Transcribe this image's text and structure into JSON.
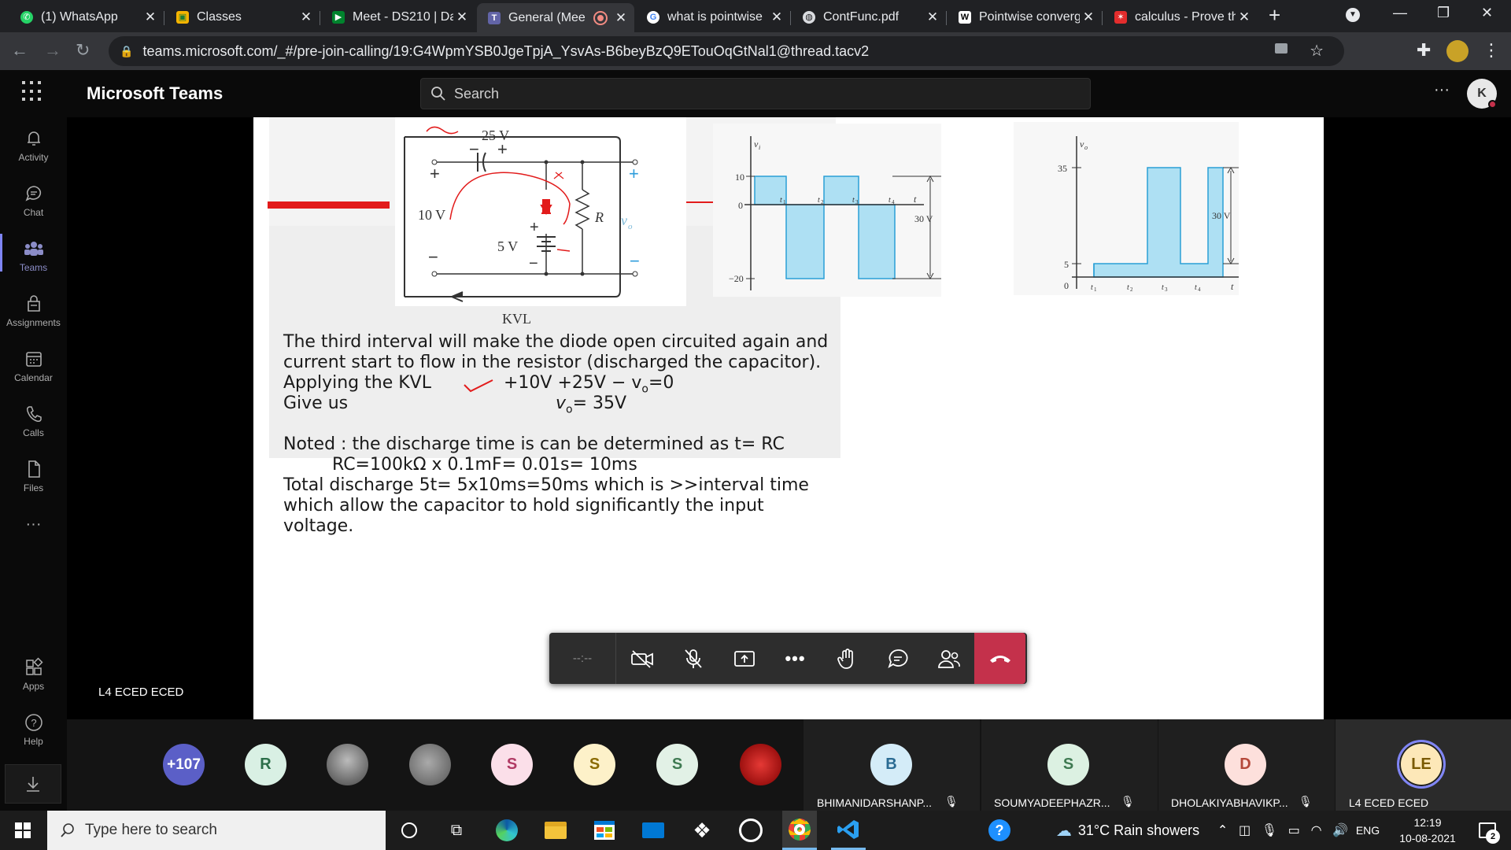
{
  "browser": {
    "tabs": [
      {
        "title": "(1) WhatsApp",
        "icon": "whatsapp-icon",
        "color": "#25d366"
      },
      {
        "title": "Classes",
        "icon": "classroom-icon",
        "color": "#f5b400"
      },
      {
        "title": "Meet - DS210 | Da",
        "icon": "meet-icon",
        "color": "#00832d"
      },
      {
        "title": "General (Mee",
        "icon": "teams-icon",
        "color": "#6264a7"
      },
      {
        "title": "what is pointwise",
        "icon": "google-icon",
        "color": "#4285f4"
      },
      {
        "title": "ContFunc.pdf",
        "icon": "globe-icon",
        "color": "#dadce0"
      },
      {
        "title": "Pointwise converg",
        "icon": "wikipedia-icon",
        "color": "#ffffff"
      },
      {
        "title": "calculus - Prove th",
        "icon": "mathse-icon",
        "color": "#e32d2d"
      }
    ],
    "url": "teams.microsoft.com/_#/pre-join-calling/19:G4WpmYSB0JgeTpjA_YsvAs-B6beyBzQ9ETouOqGtNal1@thread.tacv2",
    "new_tab": "+"
  },
  "teams": {
    "app_title": "Microsoft Teams",
    "search_placeholder": "Search",
    "profile_initial": "K",
    "more": "···",
    "rail": [
      {
        "label": "Activity",
        "icon": "bell-icon"
      },
      {
        "label": "Chat",
        "icon": "chat-icon"
      },
      {
        "label": "Teams",
        "icon": "teams-icon"
      },
      {
        "label": "Assignments",
        "icon": "assignments-icon"
      },
      {
        "label": "Calendar",
        "icon": "calendar-icon"
      },
      {
        "label": "Calls",
        "icon": "phone-icon"
      },
      {
        "label": "Files",
        "icon": "file-icon"
      }
    ],
    "rail_more": "···",
    "apps_label": "Apps",
    "help_label": "Help",
    "presenter_label": "L4 ECED ECED",
    "call_timer": "--:--"
  },
  "slide": {
    "circuit": {
      "cap_label": "25 V",
      "source_label": "10 V",
      "battery_label": "5 V",
      "r_label": "R",
      "vo_label": "v",
      "vo_sub": "o",
      "loop_label": "KVL",
      "plus": "+",
      "minus": "−"
    },
    "vi_graph": {
      "ylabel": "v",
      "ysub": "i",
      "y_top": "10",
      "y_zero": "0",
      "y_bottom": "−20",
      "span": "30 V",
      "t_label": "t",
      "ticks": [
        "t",
        "t",
        "t",
        "t"
      ],
      "tick_subs": [
        "1",
        "2",
        "3",
        "4"
      ]
    },
    "vo_graph": {
      "ylabel": "v",
      "ysub": "o",
      "y_top": "35",
      "y_low": "5",
      "y_zero": "0",
      "span": "30 V",
      "t_label": "t",
      "ticks": [
        "t",
        "t",
        "t",
        "t"
      ],
      "tick_subs": [
        "1",
        "2",
        "3",
        "4"
      ]
    },
    "text": {
      "line1": "The third interval will make the diode open circuited again and",
      "line2": "current start to flow in the resistor (discharged the capacitor).",
      "line3a": "Applying the KVL",
      "line3b": "+10V +25V − v",
      "line3b_sub": "o",
      "line3c": "=0",
      "line4a": "Give us",
      "line4b": "v",
      "line4b_sub": "o",
      "line4c": "= 35V",
      "line5": "Noted : the discharge time is can be determined as t= RC",
      "line6": "RC=100kΩ x 0.1mF= 0.01s= 10ms",
      "line7": "Total discharge 5t= 5x10ms=50ms which is >>interval time",
      "line8": "which allow the capacitor to hold significantly the input",
      "line9": "voltage."
    }
  },
  "participants": {
    "overflow": "+107",
    "avatars": [
      {
        "initial": "R",
        "bg": "#d9f0e4",
        "fg": "#2c6e49"
      },
      {
        "initial": "",
        "bg": "#6b6b6b",
        "fg": "#fff"
      },
      {
        "initial": "",
        "bg": "#8a8a8a",
        "fg": "#fff"
      },
      {
        "initial": "S",
        "bg": "#fbdfe9",
        "fg": "#b03a64"
      },
      {
        "initial": "S",
        "bg": "#fdf1c9",
        "fg": "#8a6a00"
      },
      {
        "initial": "S",
        "bg": "#e2f1e6",
        "fg": "#3f7a52"
      },
      {
        "initial": "",
        "bg": "#c62828",
        "fg": "#fff"
      }
    ],
    "tiles": [
      {
        "initial": "B",
        "name": "BHIMANIDARSHANP...",
        "bg": "#d4ecf8",
        "fg": "#2a6b93"
      },
      {
        "initial": "S",
        "name": "SOUMYADEEPHAZR...",
        "bg": "#dcf1e2",
        "fg": "#3f7a52"
      },
      {
        "initial": "D",
        "name": "DHOLAKIYABHAVIKP...",
        "bg": "#fde0dc",
        "fg": "#b5483a"
      },
      {
        "initial": "LE",
        "name": "L4 ECED ECED",
        "bg": "#fde8b8",
        "fg": "#7a5a00"
      }
    ]
  },
  "taskbar": {
    "search_placeholder": "Type here to search",
    "weather": "31°C  Rain showers",
    "lang": "ENG",
    "time": "12:19",
    "date": "10-08-2021",
    "notif_count": "2"
  }
}
